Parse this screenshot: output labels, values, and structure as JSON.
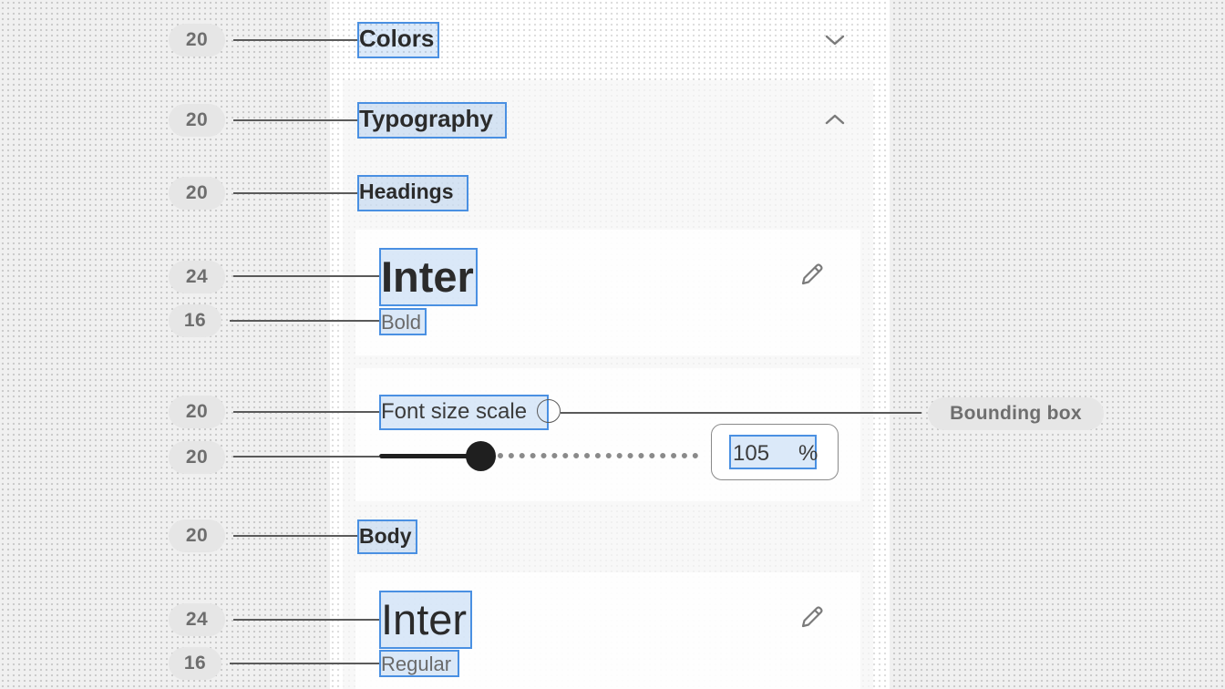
{
  "annotations": {
    "colors": "20",
    "typography": "20",
    "headings": "20",
    "heading_font": "24",
    "heading_weight": "16",
    "scale_label": "20",
    "slider": "20",
    "body": "20",
    "body_font": "24",
    "body_weight": "16"
  },
  "sections": {
    "colors": {
      "title": "Colors",
      "expanded": false,
      "icon": "chevron-down-icon"
    },
    "typography": {
      "title": "Typography",
      "expanded": true,
      "icon": "chevron-up-icon"
    }
  },
  "typography": {
    "headings": {
      "label": "Headings",
      "font_name": "Inter",
      "font_weight": "Bold",
      "edit_icon": "pencil-icon"
    },
    "scale": {
      "label": "Font size scale",
      "value": "105",
      "unit": "%",
      "slider_fraction": 0.31
    },
    "body": {
      "label": "Body",
      "font_name": "Inter",
      "font_weight": "Regular",
      "edit_icon": "pencil-icon"
    }
  },
  "callout": {
    "label": "Bounding box"
  },
  "colors": {
    "highlight": "#4a90e2",
    "text": "#2b2b2b",
    "annotation_pill": "#e6e6e6"
  }
}
